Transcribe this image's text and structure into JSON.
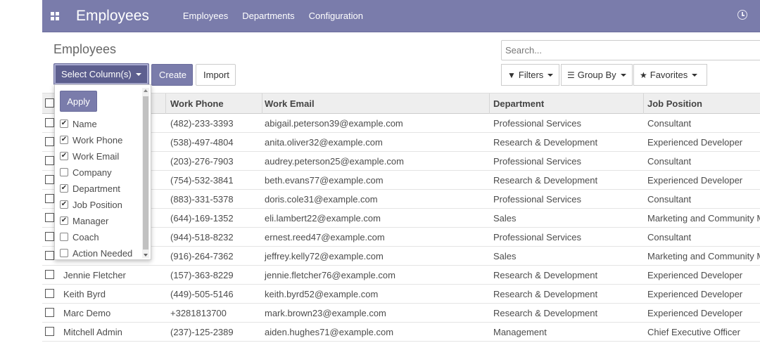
{
  "topbar": {
    "app_name": "Employees",
    "menu": [
      "Employees",
      "Departments",
      "Configuration"
    ]
  },
  "page_title": "Employees",
  "search": {
    "placeholder": "Search..."
  },
  "buttons": {
    "select_columns": "Select Column(s)",
    "create": "Create",
    "import": "Import"
  },
  "filters": {
    "filters": "Filters",
    "group_by": "Group By",
    "favorites": "Favorites"
  },
  "columns_dropdown": {
    "apply_label": "Apply",
    "options": [
      {
        "label": "Name",
        "checked": true
      },
      {
        "label": "Work Phone",
        "checked": true
      },
      {
        "label": "Work Email",
        "checked": true
      },
      {
        "label": "Company",
        "checked": false
      },
      {
        "label": "Department",
        "checked": true
      },
      {
        "label": "Job Position",
        "checked": true
      },
      {
        "label": "Manager",
        "checked": true
      },
      {
        "label": "Coach",
        "checked": false
      },
      {
        "label": "Action Needed",
        "checked": false
      }
    ]
  },
  "table": {
    "headers": [
      "",
      "Work Phone",
      "Work Email",
      "Department",
      "Job Position"
    ],
    "rows": [
      [
        "",
        "(482)-233-3393",
        "abigail.peterson39@example.com",
        "Professional Services",
        "Consultant"
      ],
      [
        "",
        "(538)-497-4804",
        "anita.oliver32@example.com",
        "Research & Development",
        "Experienced Developer"
      ],
      [
        "",
        "(203)-276-7903",
        "audrey.peterson25@example.com",
        "Professional Services",
        "Consultant"
      ],
      [
        "",
        "(754)-532-3841",
        "beth.evans77@example.com",
        "Research & Development",
        "Experienced Developer"
      ],
      [
        "",
        "(883)-331-5378",
        "doris.cole31@example.com",
        "Professional Services",
        "Consultant"
      ],
      [
        "",
        "(644)-169-1352",
        "eli.lambert22@example.com",
        "Sales",
        "Marketing and Community M"
      ],
      [
        "",
        "(944)-518-8232",
        "ernest.reed47@example.com",
        "Professional Services",
        "Consultant"
      ],
      [
        "",
        "(916)-264-7362",
        "jeffrey.kelly72@example.com",
        "Sales",
        "Marketing and Community M"
      ],
      [
        "Jennie Fletcher",
        "(157)-363-8229",
        "jennie.fletcher76@example.com",
        "Research & Development",
        "Experienced Developer"
      ],
      [
        "Keith Byrd",
        "(449)-505-5146",
        "keith.byrd52@example.com",
        "Research & Development",
        "Experienced Developer"
      ],
      [
        "Marc Demo",
        "+3281813700",
        "mark.brown23@example.com",
        "Research & Development",
        "Experienced Developer"
      ],
      [
        "Mitchell Admin",
        "(237)-125-2389",
        "aiden.hughes71@example.com",
        "Management",
        "Chief Executive Officer"
      ]
    ]
  },
  "colors": {
    "brand": "#7a7cab",
    "brand_dark": "#5d5f8f"
  }
}
